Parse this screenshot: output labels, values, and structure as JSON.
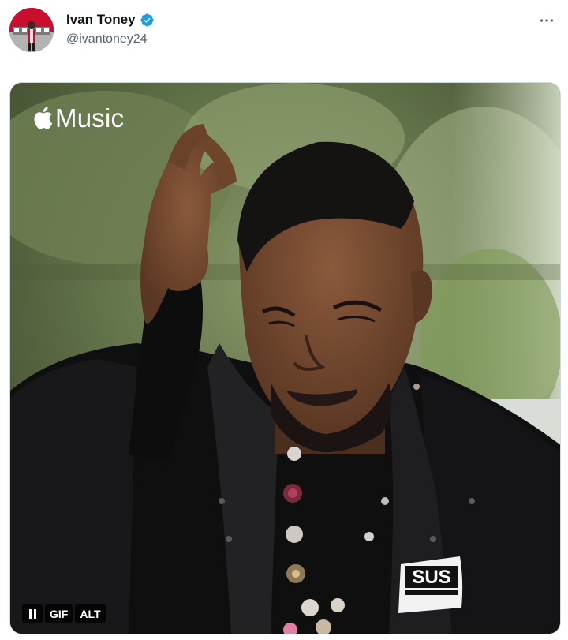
{
  "tweet": {
    "author": {
      "display_name": "Ivan Toney",
      "handle": "@ivantoney24",
      "verified": true,
      "verified_color": "#1d9bf0"
    },
    "more_icon": "more-horizontal-icon",
    "media": {
      "type": "gif",
      "brand_text": "Music",
      "brand_icon": "apple-logo-icon",
      "controls": {
        "pause_icon": "pause-icon",
        "gif_label": "GIF",
        "alt_label": "ALT"
      }
    }
  }
}
